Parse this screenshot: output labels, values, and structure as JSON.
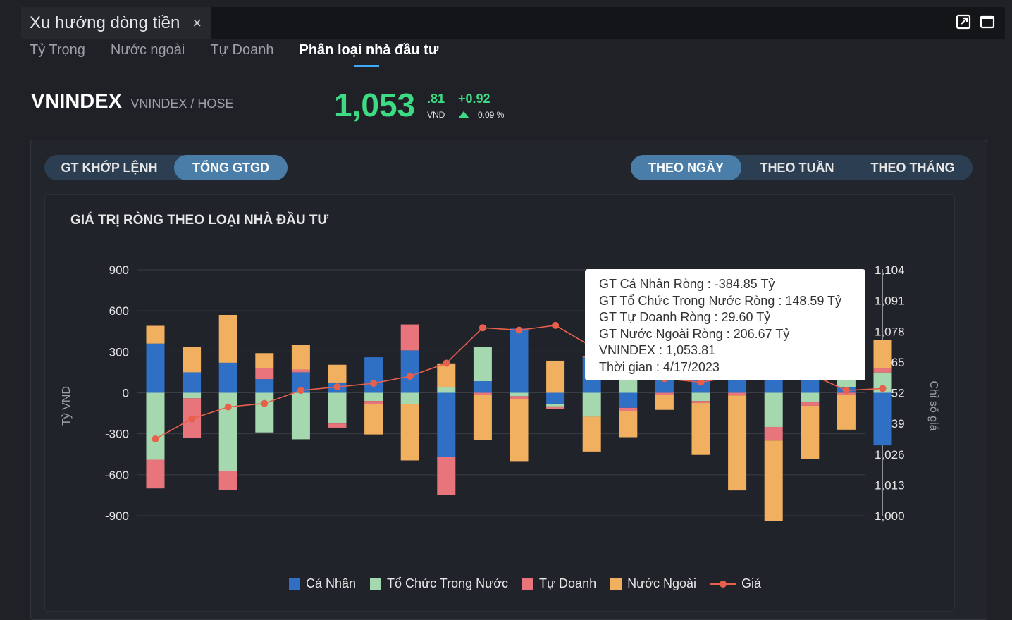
{
  "window": {
    "title": "Xu hướng dòng tiền",
    "close_glyph": "×"
  },
  "tabs": [
    {
      "label": "Tỷ Trọng"
    },
    {
      "label": "Nước ngoài"
    },
    {
      "label": "Tự Doanh"
    },
    {
      "label": "Phân loại nhà đầu tư"
    }
  ],
  "ticker": {
    "symbol": "VNINDEX",
    "exchange": "VNINDEX / HOSE",
    "price_int": "1,053",
    "price_dec": ".81",
    "currency": "VND",
    "change": "+0.92",
    "change_pct": "0.09 %"
  },
  "value_toggle": [
    {
      "label": "GT KHỚP LỆNH",
      "active": false
    },
    {
      "label": "TỔNG GTGD",
      "active": true
    }
  ],
  "period_toggle": [
    {
      "label": "THEO NGÀY",
      "active": true
    },
    {
      "label": "THEO TUẦN",
      "active": false
    },
    {
      "label": "THEO THÁNG",
      "active": false
    }
  ],
  "tooltip": {
    "lines": [
      "GT Cá Nhân Ròng  : -384.85 Tỷ",
      "GT Tổ Chức Trong Nước Ròng : 148.59 Tỷ",
      "GT Tự Doanh Ròng : 29.60 Tỷ",
      "GT Nước Ngoài Ròng : 206.67 Tỷ",
      "VNINDEX : 1,053.81",
      "Thời gian : 4/17/2023"
    ]
  },
  "colors": {
    "ca_nhan": "#2f6fc4",
    "to_chuc": "#a6d8b0",
    "tu_doanh": "#e8747c",
    "nuoc_ngoai": "#f0b060",
    "gia": "#e8604c"
  },
  "chart_data": {
    "type": "bar",
    "title": "GIÁ TRỊ RÒNG THEO LOẠI NHÀ ĐẦU TƯ",
    "ylabel": "Tỷ VND",
    "y2label": "Chỉ số giá",
    "ylim": [
      -900,
      900
    ],
    "y2lim": [
      1000,
      1104
    ],
    "y_ticks": [
      "900",
      "600",
      "300",
      "0",
      "-300",
      "-600",
      "-900"
    ],
    "y2_ticks": [
      "1,104",
      "1,091",
      "1,078",
      "1,065",
      "1,052",
      "1,039",
      "1,026",
      "1,013",
      "1,000"
    ],
    "stacked": true,
    "grid": true,
    "legend_position": "bottom",
    "series": [
      {
        "name": "Cá Nhân",
        "values": [
          360,
          150,
          220,
          100,
          150,
          75,
          260,
          310,
          -470,
          85,
          470,
          -80,
          260,
          -110,
          240,
          165,
          185,
          270,
          240,
          40,
          -384.85
        ]
      },
      {
        "name": "Tổ Chức Trong Nước",
        "values": [
          -490,
          -40,
          -570,
          -290,
          -340,
          -225,
          -60,
          -80,
          40,
          250,
          -25,
          -20,
          -175,
          135,
          250,
          -60,
          220,
          -250,
          -70,
          175,
          148.59
        ]
      },
      {
        "name": "Tự Doanh",
        "values": [
          -210,
          -290,
          -140,
          80,
          20,
          -30,
          -20,
          190,
          -280,
          -15,
          -20,
          -20,
          10,
          -25,
          -15,
          -15,
          -20,
          -100,
          -25,
          -15,
          29.6
        ]
      },
      {
        "name": "Nước Ngoài",
        "values": [
          130,
          185,
          350,
          110,
          180,
          130,
          -225,
          -415,
          175,
          -330,
          -460,
          235,
          -255,
          -190,
          -110,
          -380,
          -695,
          -590,
          -390,
          -255,
          206.67
        ]
      },
      {
        "name": "Giá",
        "values": [
          1032.5,
          1041,
          1046,
          1047.5,
          1053,
          1054.5,
          1056,
          1059,
          1064.5,
          1079.5,
          1078.5,
          1080.5,
          1071.5,
          1060.5,
          1058,
          1056.5,
          1059,
          1061,
          1060,
          1053,
          1053.81
        ]
      }
    ]
  },
  "legend": [
    {
      "label": "Cá Nhân"
    },
    {
      "label": "Tổ Chức Trong Nước"
    },
    {
      "label": "Tự Doanh"
    },
    {
      "label": "Nước Ngoài"
    },
    {
      "label": "Giá"
    }
  ]
}
